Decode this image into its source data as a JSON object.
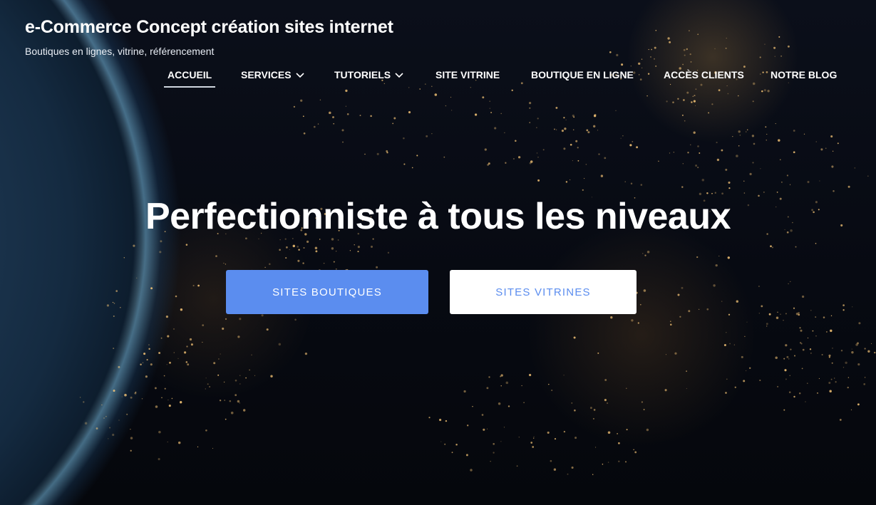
{
  "header": {
    "site_title": "e-Commerce Concept création sites internet",
    "tagline": "Boutiques en lignes, vitrine, référencement"
  },
  "nav": {
    "items": [
      {
        "label": "ACCUEIL",
        "active": true,
        "has_dropdown": false
      },
      {
        "label": "SERVICES",
        "active": false,
        "has_dropdown": true
      },
      {
        "label": "TUTORIELS",
        "active": false,
        "has_dropdown": true
      },
      {
        "label": "SITE VITRINE",
        "active": false,
        "has_dropdown": false
      },
      {
        "label": "BOUTIQUE EN LIGNE",
        "active": false,
        "has_dropdown": false
      },
      {
        "label": "ACCÈS CLIENTS",
        "active": false,
        "has_dropdown": false
      },
      {
        "label": "NOTRE BLOG",
        "active": false,
        "has_dropdown": false
      }
    ]
  },
  "hero": {
    "headline": "Perfectionniste à tous les niveaux",
    "primary_button": "SITES BOUTIQUES",
    "secondary_button": "SITES VITRINES",
    "background_image": "earth-at-night"
  },
  "colors": {
    "accent": "#5b8def",
    "text": "#ffffff",
    "background": "#05070e"
  }
}
